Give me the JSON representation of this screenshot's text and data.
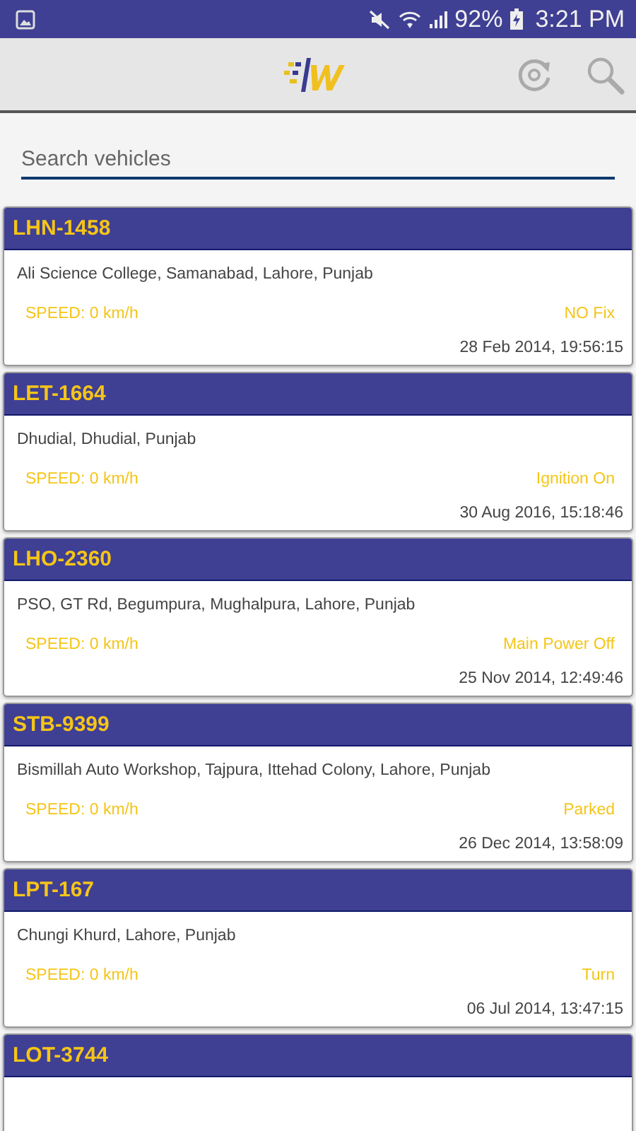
{
  "status_bar": {
    "battery": "92%",
    "time": "3:21 PM"
  },
  "search": {
    "placeholder": "Search vehicles"
  },
  "vehicles": [
    {
      "plate": "LHN-1458",
      "address": "Ali Science College, Samanabad, Lahore, Punjab",
      "speed": "SPEED: 0 km/h",
      "status": "NO Fix",
      "timestamp": "28 Feb 2014, 19:56:15"
    },
    {
      "plate": "LET-1664",
      "address": "Dhudial, Dhudial, Punjab",
      "speed": "SPEED: 0 km/h",
      "status": "Ignition On",
      "timestamp": "30 Aug 2016, 15:18:46"
    },
    {
      "plate": "LHO-2360",
      "address": "PSO, GT Rd, Begumpura, Mughalpura, Lahore, Punjab",
      "speed": "SPEED: 0 km/h",
      "status": "Main Power Off",
      "timestamp": "25 Nov 2014, 12:49:46"
    },
    {
      "plate": "STB-9399",
      "address": "Bismillah Auto Workshop, Tajpura, Ittehad Colony, Lahore, Punjab",
      "speed": "SPEED: 0 km/h",
      "status": "Parked",
      "timestamp": "26 Dec 2014, 13:58:09"
    },
    {
      "plate": "LPT-167",
      "address": "Chungi Khurd, Lahore, Punjab",
      "speed": "SPEED: 0 km/h",
      "status": "Turn",
      "timestamp": "06 Jul 2014, 13:47:15"
    },
    {
      "plate": "LOT-3744"
    }
  ]
}
